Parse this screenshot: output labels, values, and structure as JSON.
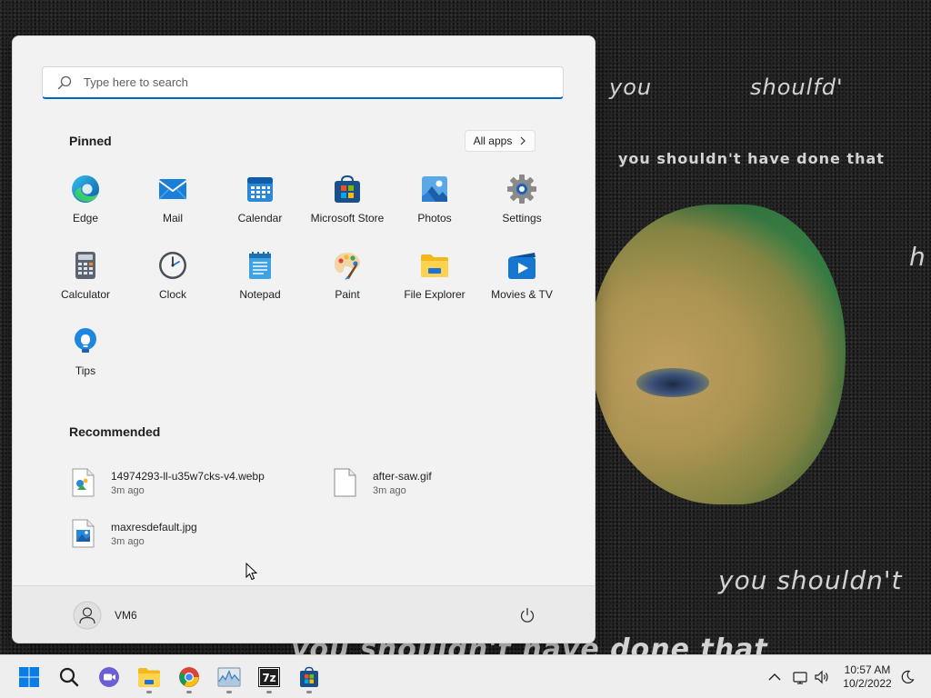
{
  "wallpaper": {
    "texts": [
      "you",
      "shoulfd'",
      "you shouldn't have done that",
      "h",
      "you shouldn't",
      "you shouldn't have done that"
    ]
  },
  "start_menu": {
    "search": {
      "placeholder": "Type here to search"
    },
    "pinned": {
      "title": "Pinned",
      "all_apps_label": "All apps",
      "apps": [
        {
          "label": "Edge",
          "icon": "edge-icon"
        },
        {
          "label": "Mail",
          "icon": "mail-icon"
        },
        {
          "label": "Calendar",
          "icon": "calendar-icon"
        },
        {
          "label": "Microsoft Store",
          "icon": "store-icon"
        },
        {
          "label": "Photos",
          "icon": "photos-icon"
        },
        {
          "label": "Settings",
          "icon": "gear-icon"
        },
        {
          "label": "Calculator",
          "icon": "calculator-icon"
        },
        {
          "label": "Clock",
          "icon": "clock-icon"
        },
        {
          "label": "Notepad",
          "icon": "notepad-icon"
        },
        {
          "label": "Paint",
          "icon": "paint-icon"
        },
        {
          "label": "File Explorer",
          "icon": "folder-icon"
        },
        {
          "label": "Movies & TV",
          "icon": "movies-icon"
        },
        {
          "label": "Tips",
          "icon": "lightbulb-icon"
        }
      ]
    },
    "recommended": {
      "title": "Recommended",
      "items": [
        {
          "name": "14974293-ll-u35w7cks-v4.webp",
          "time": "3m ago",
          "icon": "image-file-icon"
        },
        {
          "name": "after-saw.gif",
          "time": "3m ago",
          "icon": "blank-file-icon"
        },
        {
          "name": "maxresdefault.jpg",
          "time": "3m ago",
          "icon": "image-file-icon"
        }
      ]
    },
    "user": {
      "name": "VM6"
    }
  },
  "taskbar": {
    "apps": [
      "start-icon",
      "search-icon",
      "chat-icon",
      "folder-icon",
      "chrome-icon",
      "task-manager-icon",
      "7zip-icon",
      "store-icon"
    ],
    "clock": {
      "time": "10:57 AM",
      "date": "10/2/2022"
    }
  },
  "colors": {
    "accent": "#0067c0",
    "menu_bg": "#f2f2f2",
    "taskbar_bg": "#eeeeee"
  }
}
